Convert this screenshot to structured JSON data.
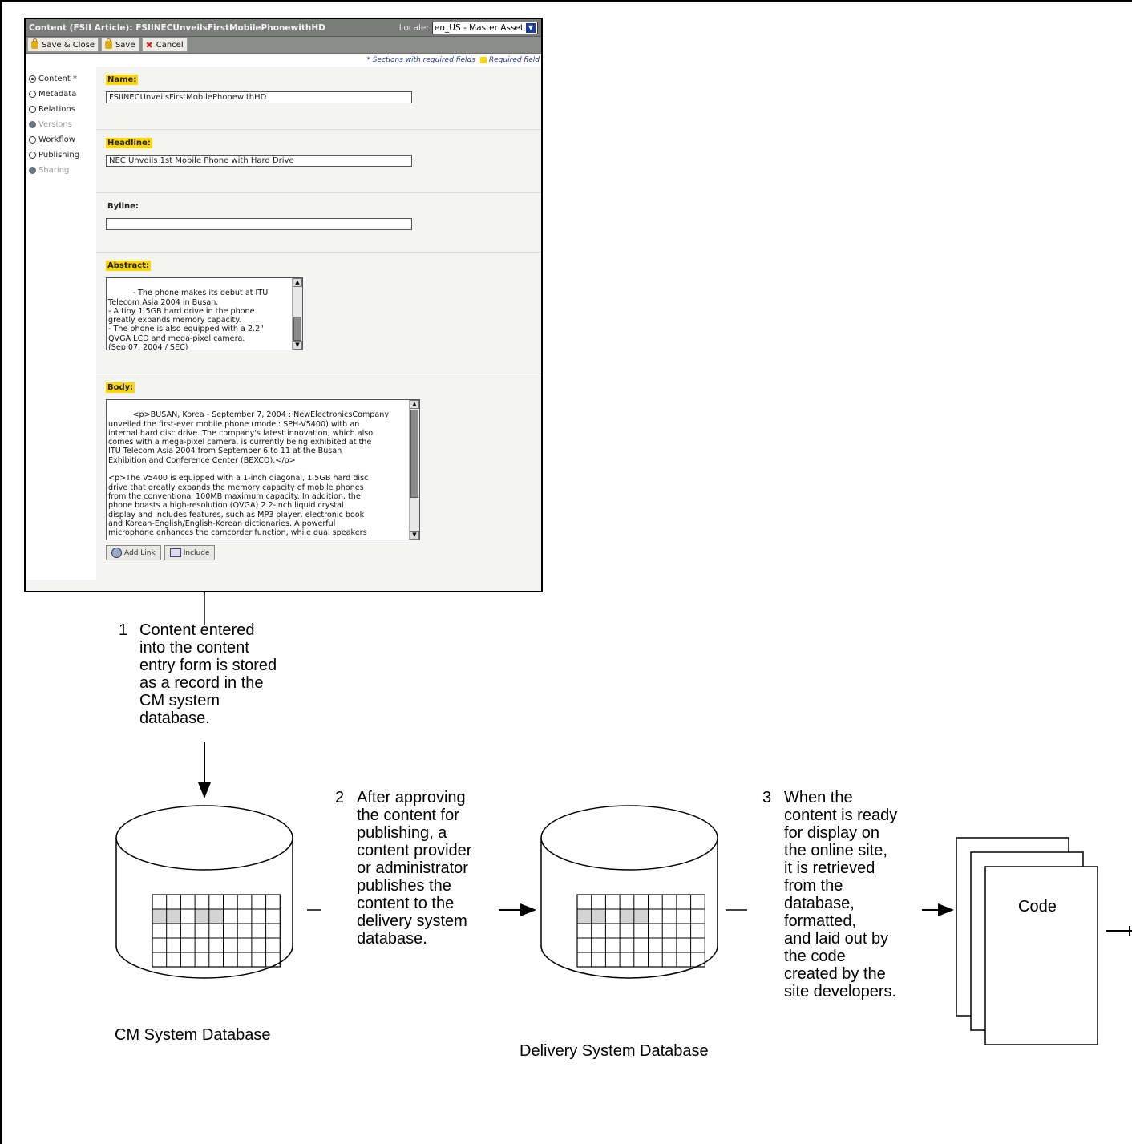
{
  "cms_form": {
    "title": "Content (FSII Article): FSIINECUnveilsFirstMobilePhonewithHD",
    "locale_label": "Locale:",
    "locale_value": "en_US - Master Asset",
    "toolbar": {
      "save_close": "Save & Close",
      "save": "Save",
      "cancel": "Cancel"
    },
    "required_note": "* Sections with required fields",
    "required_field_note": "Required field",
    "nav": [
      {
        "label": "Content *",
        "state": "checked"
      },
      {
        "label": "Metadata",
        "state": "empty"
      },
      {
        "label": "Relations",
        "state": "empty"
      },
      {
        "label": "Versions",
        "state": "disabled"
      },
      {
        "label": "Workflow",
        "state": "empty"
      },
      {
        "label": "Publishing",
        "state": "empty"
      },
      {
        "label": "Sharing",
        "state": "disabled"
      }
    ],
    "fields": {
      "name_label": "Name:",
      "name_value": "FSIINECUnveilsFirstMobilePhonewithHD",
      "headline_label": "Headline:",
      "headline_value": "NEC Unveils 1st Mobile Phone with Hard Drive",
      "byline_label": "Byline:",
      "byline_value": "",
      "abstract_label": "Abstract:",
      "abstract_value": "- The phone makes its debut at ITU\nTelecom Asia 2004 in Busan.\n- A tiny 1.5GB hard drive in the phone\ngreatly expands memory capacity.\n- The phone is also equipped with a 2.2\"\nQVGA LCD and mega-pixel camera.\n(Sep 07, 2004 / SEC)",
      "body_label": "Body:",
      "body_value": "<p>BUSAN, Korea - September 7, 2004 : NewElectronicsCompany\nunveiled the first-ever mobile phone (model: SPH-V5400) with an\ninternal hard disc drive. The company's latest innovation, which also\ncomes with a mega-pixel camera, is currently being exhibited at the\nITU Telecom Asia 2004 from September 6 to 11 at the Busan\nExhibition and Conference Center (BEXCO).</p>\n\n<p>The V5400 is equipped with a 1-inch diagonal, 1.5GB hard disc\ndrive that greatly expands the memory capacity of mobile phones\nfrom the conventional 100MB maximum capacity. In addition, the\nphone boasts a high-resolution (QVGA) 2.2-inch liquid crystal\ndisplay and includes features, such as MP3 player, electronic book\nand Korean-English/English-Korean dictionaries. A powerful\nmicrophone enhances the camcorder function, while dual speakers",
      "add_link": "Add Link",
      "include": "Include"
    }
  },
  "steps": [
    {
      "number": "1",
      "text": "Content entered\ninto the content\nentry form is stored\nas a record in the\nCM system\ndatabase."
    },
    {
      "number": "2",
      "text": "After approving\nthe content for\npublishing, a\ncontent provider\nor administrator\npublishes the\ncontent to the\ndelivery system\ndatabase."
    },
    {
      "number": "3",
      "text": "When the\ncontent is ready\nfor display on\nthe online site,\nit is retrieved\nfrom the\ndatabase,\nformatted,\nand laid out by\nthe code\ncreated by the\nsite developers."
    }
  ],
  "databases": {
    "cm": "CM System Database",
    "delivery": "Delivery System Database"
  },
  "code_label": "Code",
  "colors": {
    "required_highlight": "#ffd700",
    "title_bar": "#7b7d7b",
    "highlight_cell": "#d4d4d4"
  }
}
